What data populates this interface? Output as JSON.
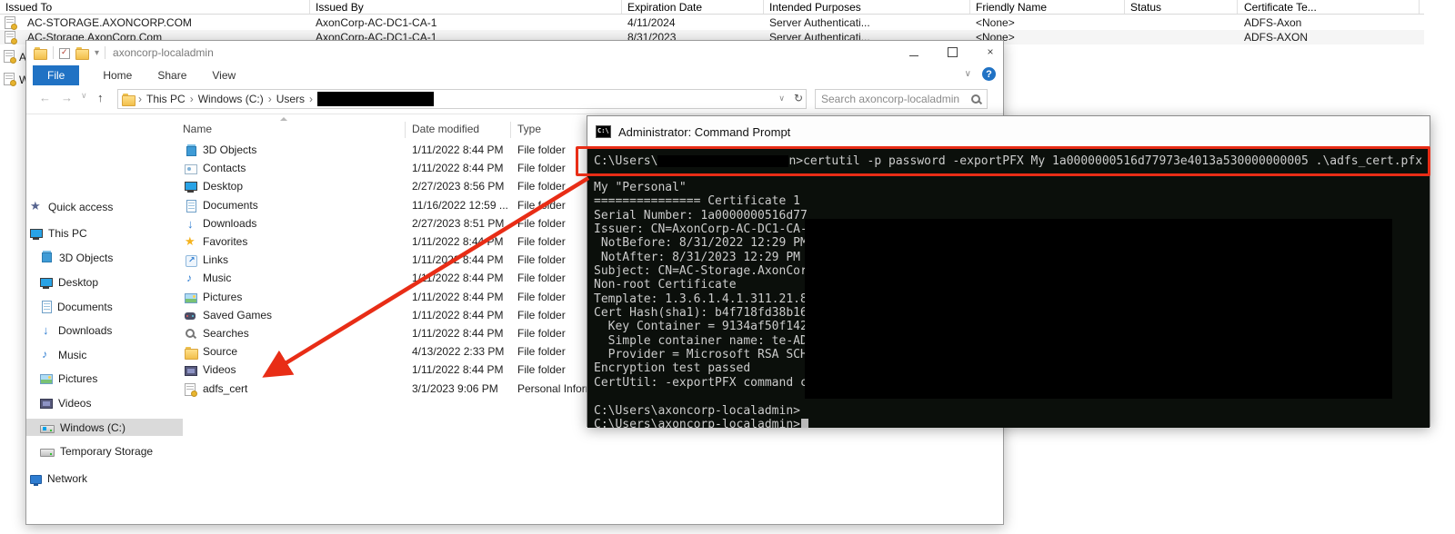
{
  "certmgr": {
    "columns": [
      "Issued To",
      "Issued By",
      "Expiration Date",
      "Intended Purposes",
      "Friendly Name",
      "Status",
      "Certificate Te..."
    ],
    "rows": [
      {
        "issued_to": "AC-STORAGE.AXONCORP.COM",
        "issued_by": "AxonCorp-AC-DC1-CA-1",
        "expiration": "4/11/2024",
        "purposes": "Server Authenticati...",
        "friendly": "<None>",
        "status": "",
        "template": "ADFS-Axon"
      },
      {
        "issued_to": "AC-Storage.AxonCorp.Com",
        "issued_by": "AxonCorp-AC-DC1-CA-1",
        "expiration": "8/31/2023",
        "purposes": "Server Authenticati...",
        "friendly": "<None>",
        "status": "",
        "template": "ADFS-AXON"
      }
    ],
    "partial_rows": [
      {
        "letter": "A"
      },
      {
        "letter": "W"
      }
    ]
  },
  "explorer": {
    "title": "axoncorp-localadmin",
    "tabs": [
      "File",
      "Home",
      "Share",
      "View"
    ],
    "breadcrumb": [
      "This PC",
      "Windows (C:)",
      "Users"
    ],
    "search_placeholder": "Search axoncorp-localadmin",
    "sidebar": [
      {
        "label": "Quick access",
        "icon": "star-qa",
        "level": 0,
        "selected": false
      },
      {
        "label": "This PC",
        "icon": "pc",
        "level": 0,
        "selected": false
      },
      {
        "label": "3D Objects",
        "icon": "cube",
        "level": 1,
        "selected": false
      },
      {
        "label": "Desktop",
        "icon": "monitor",
        "level": 1,
        "selected": false
      },
      {
        "label": "Documents",
        "icon": "doc",
        "level": 1,
        "selected": false
      },
      {
        "label": "Downloads",
        "icon": "down",
        "level": 1,
        "selected": false
      },
      {
        "label": "Music",
        "icon": "note",
        "level": 1,
        "selected": false
      },
      {
        "label": "Pictures",
        "icon": "picture",
        "level": 1,
        "selected": false
      },
      {
        "label": "Videos",
        "icon": "film",
        "level": 1,
        "selected": false
      },
      {
        "label": "Windows (C:)",
        "icon": "drive-win",
        "level": 1,
        "selected": true
      },
      {
        "label": "Temporary Storage",
        "icon": "drive",
        "level": 1,
        "selected": false
      },
      {
        "label": "Network",
        "icon": "network",
        "level": 0,
        "selected": false
      }
    ],
    "list_columns": [
      "Name",
      "Date modified",
      "Type"
    ],
    "files": [
      {
        "name": "3D Objects",
        "date": "1/11/2022 8:44 PM",
        "type": "File folder",
        "icon": "cube"
      },
      {
        "name": "Contacts",
        "date": "1/11/2022 8:44 PM",
        "type": "File folder",
        "icon": "contacts"
      },
      {
        "name": "Desktop",
        "date": "2/27/2023 8:56 PM",
        "type": "File folder",
        "icon": "monitor"
      },
      {
        "name": "Documents",
        "date": "11/16/2022 12:59 ...",
        "type": "File folder",
        "icon": "doc"
      },
      {
        "name": "Downloads",
        "date": "2/27/2023 8:51 PM",
        "type": "File folder",
        "icon": "down"
      },
      {
        "name": "Favorites",
        "date": "1/11/2022 8:44 PM",
        "type": "File folder",
        "icon": "star-gold"
      },
      {
        "name": "Links",
        "date": "1/11/2022 8:44 PM",
        "type": "File folder",
        "icon": "link"
      },
      {
        "name": "Music",
        "date": "1/11/2022 8:44 PM",
        "type": "File folder",
        "icon": "note"
      },
      {
        "name": "Pictures",
        "date": "1/11/2022 8:44 PM",
        "type": "File folder",
        "icon": "picture"
      },
      {
        "name": "Saved Games",
        "date": "1/11/2022 8:44 PM",
        "type": "File folder",
        "icon": "game"
      },
      {
        "name": "Searches",
        "date": "1/11/2022 8:44 PM",
        "type": "File folder",
        "icon": "search"
      },
      {
        "name": "Source",
        "date": "4/13/2022 2:33 PM",
        "type": "File folder",
        "icon": "folder"
      },
      {
        "name": "Videos",
        "date": "1/11/2022 8:44 PM",
        "type": "File folder",
        "icon": "film"
      },
      {
        "name": "adfs_cert",
        "date": "3/1/2023 9:06 PM",
        "type": "Personal Inform",
        "icon": "cert"
      }
    ]
  },
  "cmd": {
    "title": "Administrator: Command Prompt",
    "command_prefix": "C:\\Users\\",
    "command_rest": "n>certutil -p password -exportPFX My 1a0000000516d77973e4013a530000000005 .\\adfs_cert.pfx",
    "output_lines": [
      "My \"Personal\"",
      "=============== Certificate 1",
      "Serial Number: 1a0000000516d77",
      "Issuer: CN=AxonCorp-AC-DC1-CA-",
      " NotBefore: 8/31/2022 12:29 PM",
      " NotAfter: 8/31/2023 12:29 PM",
      "Subject: CN=AC-Storage.AxonCor",
      "Non-root Certificate",
      "Template: 1.3.6.1.4.1.311.21.8",
      "Cert Hash(sha1): b4f718fd38b16",
      "  Key Container = 9134af50f142",
      "  Simple container name: te-AD",
      "  Provider = Microsoft RSA SCH",
      "Encryption test passed",
      "CertUtil: -exportPFX command completed successfully.",
      "",
      "C:\\Users\\axoncorp-localadmin>",
      "C:\\Users\\axoncorp-localadmin>"
    ]
  },
  "colors": {
    "accent_blue": "#2072c4",
    "highlight_red": "#e82d16",
    "terminal_bg": "#0b0f0b",
    "terminal_fg": "#cccccc",
    "selection_gray": "#dadada",
    "redaction_black": "#000000"
  }
}
